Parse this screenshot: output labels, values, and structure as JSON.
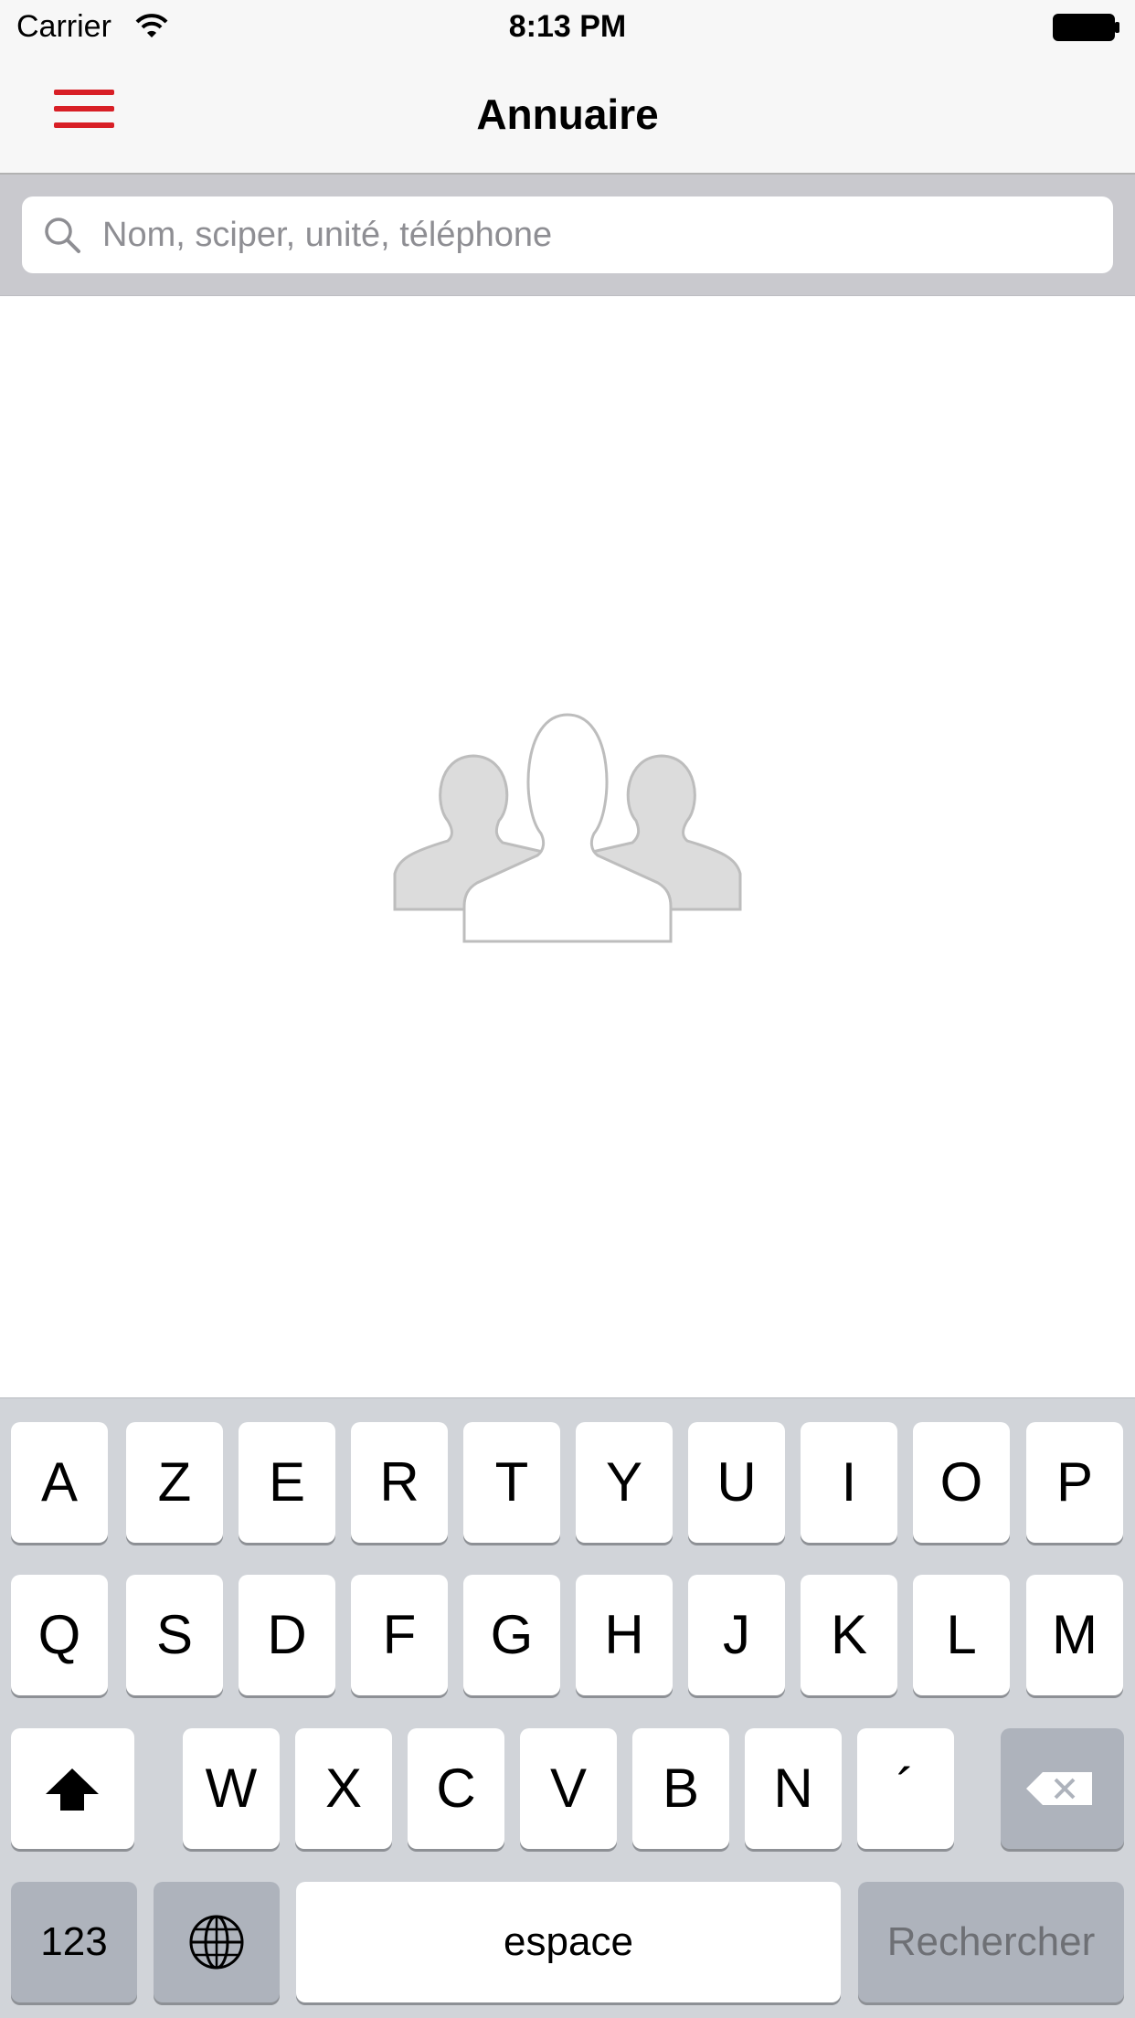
{
  "status_bar": {
    "carrier": "Carrier",
    "time": "8:13 PM"
  },
  "nav": {
    "title": "Annuaire",
    "accent_color": "#d81f26"
  },
  "search": {
    "placeholder": "Nom, sciper, unité, téléphone",
    "value": ""
  },
  "keyboard": {
    "row1": [
      "A",
      "Z",
      "E",
      "R",
      "T",
      "Y",
      "U",
      "I",
      "O",
      "P"
    ],
    "row2": [
      "Q",
      "S",
      "D",
      "F",
      "G",
      "H",
      "J",
      "K",
      "L",
      "M"
    ],
    "row3": [
      "W",
      "X",
      "C",
      "V",
      "B",
      "N",
      "´"
    ],
    "numbers_label": "123",
    "space_label": "espace",
    "search_label": "Rechercher"
  }
}
